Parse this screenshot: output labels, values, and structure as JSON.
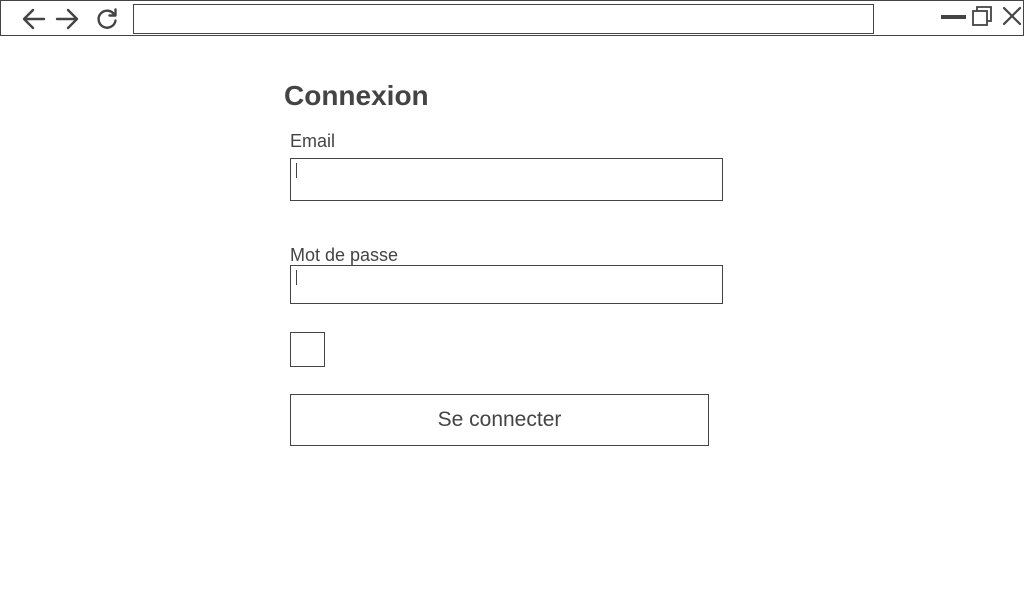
{
  "browser": {
    "address_value": "",
    "icons": {
      "back": "arrow-left-icon",
      "forward": "arrow-right-icon",
      "reload": "reload-icon",
      "minimize": "minimize-icon",
      "maximize": "maximize-icon",
      "close": "close-icon"
    }
  },
  "login": {
    "title": "Connexion",
    "email_label": "Email",
    "password_label": "Mot de passe",
    "submit_label": "Se connecter",
    "checkbox_checked": false
  },
  "colors": {
    "foreground": "#444444",
    "background": "#ffffff"
  }
}
